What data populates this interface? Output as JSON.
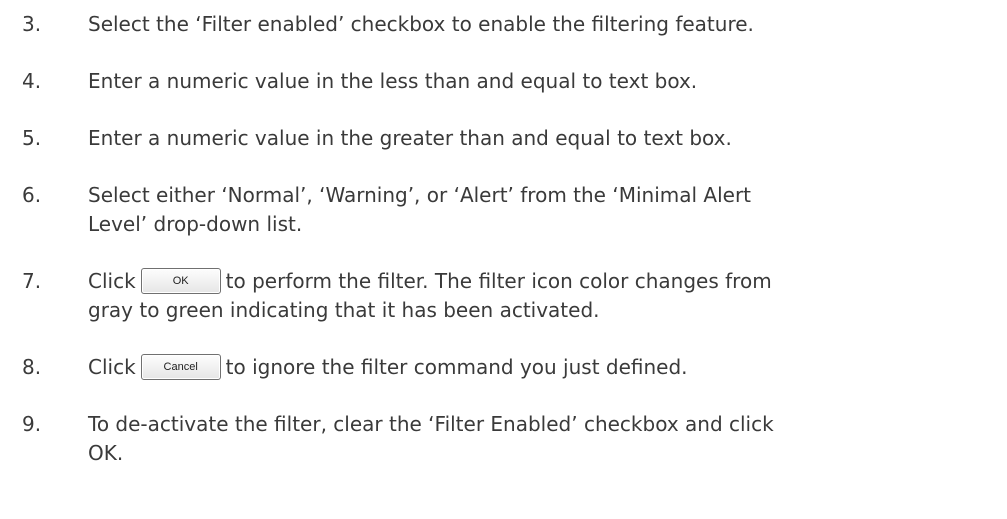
{
  "steps": [
    {
      "num": "3.",
      "text": "Select the ‘Filter enabled’ checkbox to enable the filtering feature."
    },
    {
      "num": "4.",
      "text": "Enter a numeric value in the less than and equal to text box."
    },
    {
      "num": "5.",
      "text": "Enter a numeric value in the greater than and equal to text box."
    },
    {
      "num": "6.",
      "line1": "Select either ‘Normal’, ‘Warning’, or ‘Alert’ from the ‘Minimal Alert",
      "line2": "Level’ drop-down list."
    },
    {
      "num": "7.",
      "pre": "Click",
      "button": "OK",
      "post": "to perform the filter. The filter icon color changes from",
      "line2": "gray to green indicating that it has been activated."
    },
    {
      "num": "8.",
      "pre": "Click",
      "button": "Cancel",
      "post": "to ignore the filter command you just defined."
    },
    {
      "num": "9.",
      "line1": "To de-activate the filter, clear the ‘Filter Enabled’ checkbox and click",
      "line2": "OK."
    }
  ]
}
